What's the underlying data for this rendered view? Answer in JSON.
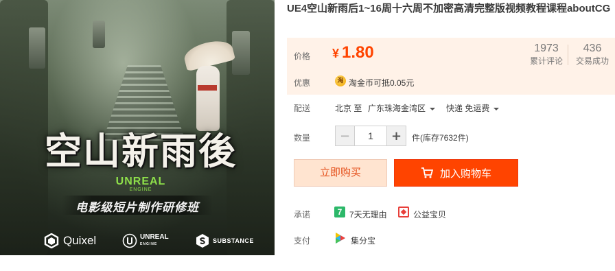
{
  "product": {
    "title": "UE4空山新雨后1~16周十六周不加密高清完整版视频教程课程aboutCG"
  },
  "image": {
    "promo_title": "空山新雨後",
    "brand_word": "UNREAL",
    "brand_sub": "ENGINE",
    "promo_subtitle": "电影级短片制作研修班",
    "logos": {
      "quixel": "Quixel",
      "unreal_top": "UNREAL",
      "unreal_bottom": "ENGINE",
      "substance": "SUBSTANCE"
    }
  },
  "price": {
    "label": "价格",
    "currency": "¥",
    "value": "1.80",
    "reviews_count": "1973",
    "reviews_label": "累计评论",
    "deals_count": "436",
    "deals_label": "交易成功"
  },
  "promotion": {
    "label": "优惠",
    "icon_char": "淘",
    "text": "淘金币可抵0.05元"
  },
  "shipping": {
    "label": "配送",
    "from": "北京 至",
    "to": "广东珠海金湾区",
    "method": "快递 免运费"
  },
  "quantity": {
    "label": "数量",
    "value": "1",
    "stock": "件(库存7632件)"
  },
  "actions": {
    "buy_now": "立即购买",
    "add_to_cart": "加入购物车"
  },
  "promise": {
    "label": "承诺",
    "badge": "7",
    "item1": "7天无理由",
    "item2": "公益宝贝"
  },
  "payment": {
    "label": "支付",
    "method": "集分宝"
  },
  "colors": {
    "accent": "#ff4400",
    "price_bg": "#fff2e8",
    "buy_now_bg": "#ffe4d0",
    "brand_green": "#8ee04a"
  }
}
